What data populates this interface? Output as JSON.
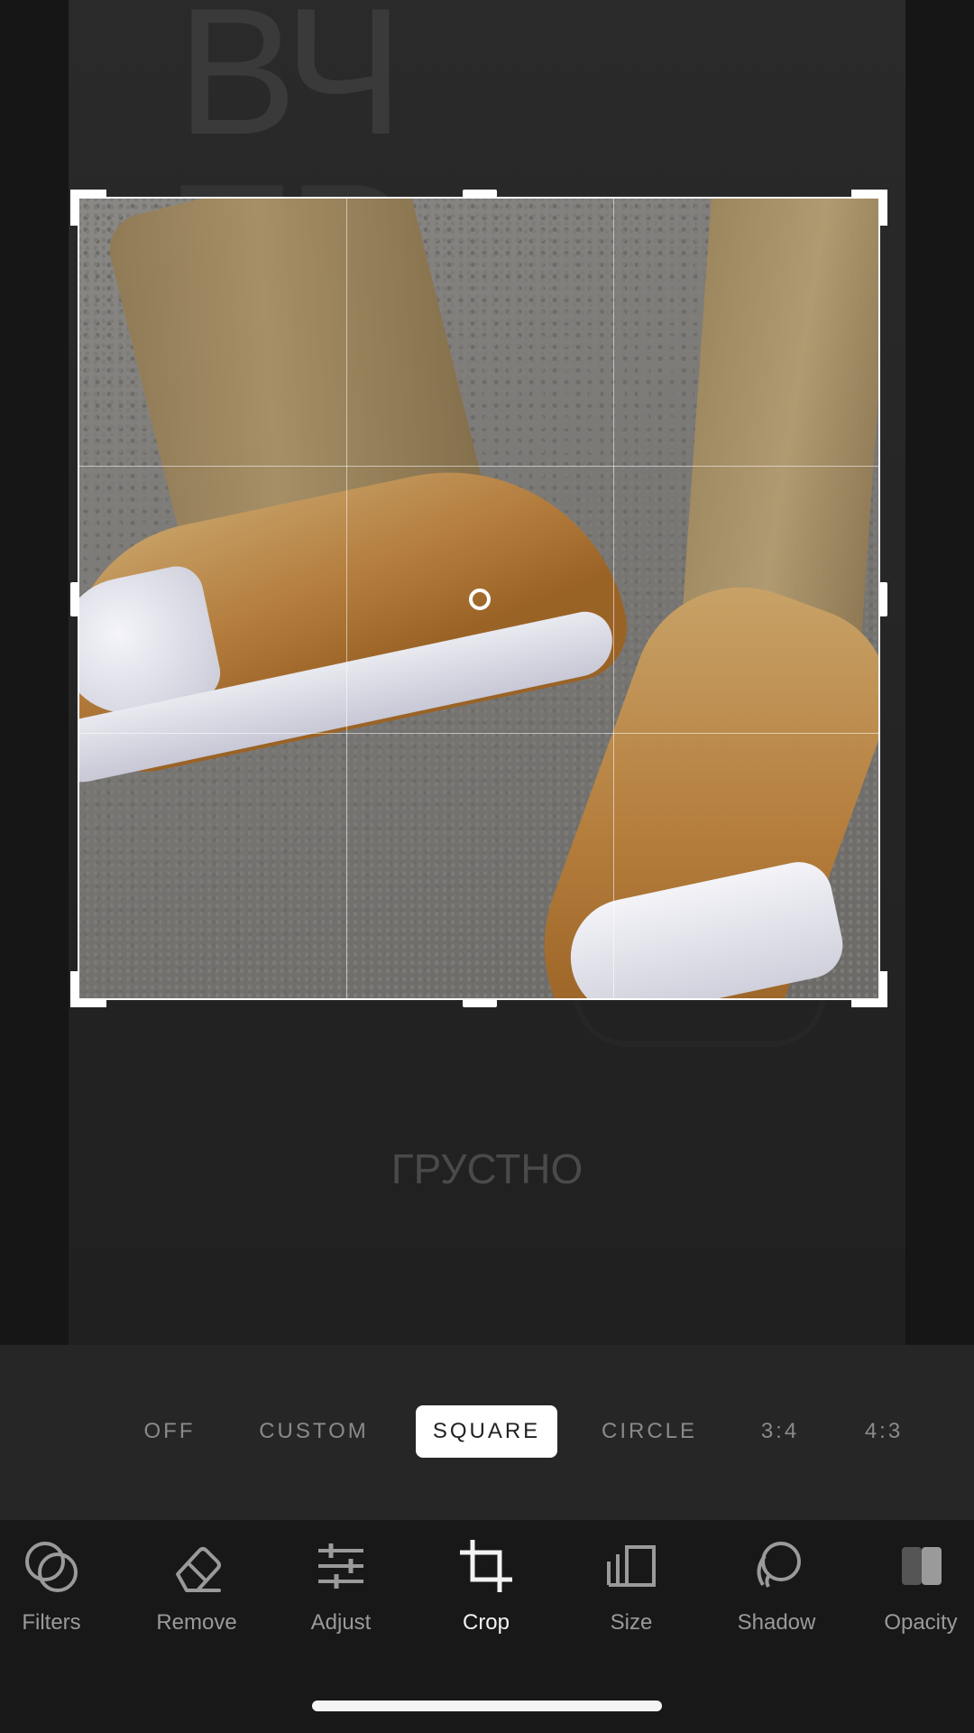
{
  "canvas": {
    "background_letters_top": "ВЧ",
    "background_letters_second": "ТР",
    "background_caption": "ГРУСТНО"
  },
  "aspect_options": [
    {
      "label": "OFF",
      "selected": false
    },
    {
      "label": "CUSTOM",
      "selected": false
    },
    {
      "label": "SQUARE",
      "selected": true
    },
    {
      "label": "CIRCLE",
      "selected": false
    },
    {
      "label": "3:4",
      "selected": false
    },
    {
      "label": "4:3",
      "selected": false
    }
  ],
  "tools": [
    {
      "label": "Filters",
      "icon": "filters-icon",
      "active": false
    },
    {
      "label": "Remove",
      "icon": "eraser-icon",
      "active": false
    },
    {
      "label": "Adjust",
      "icon": "sliders-icon",
      "active": false
    },
    {
      "label": "Crop",
      "icon": "crop-icon",
      "active": true
    },
    {
      "label": "Size",
      "icon": "size-icon",
      "active": false
    },
    {
      "label": "Shadow",
      "icon": "shadow-icon",
      "active": false
    },
    {
      "label": "Opacity",
      "icon": "opacity-icon",
      "active": false
    }
  ],
  "colors": {
    "active_tool": "#f2f2f2",
    "inactive_tool": "#9a9a9a",
    "selected_pill": "#ffffff"
  }
}
